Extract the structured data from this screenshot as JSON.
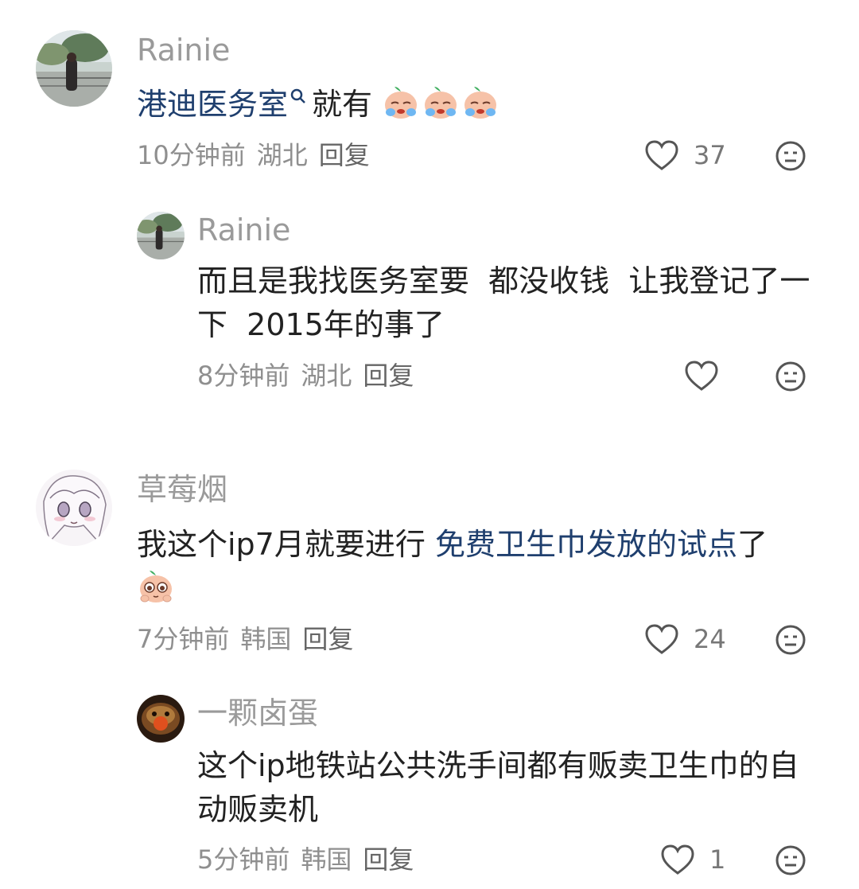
{
  "comments": [
    {
      "username": "Rainie",
      "text_link": "港迪医务室",
      "text_after": "就有",
      "time": "10分钟前",
      "location": "湖北",
      "reply": "回复",
      "likes": "37"
    },
    {
      "username": "Rainie",
      "text": "而且是我找医务室要  都没收钱  让我登记了一下  2015年的事了",
      "time": "8分钟前",
      "location": "湖北",
      "reply": "回复"
    },
    {
      "username": "草莓烟",
      "text_before": "我这个ip7月就要进行 ",
      "text_link": "免费卫生巾发放的试点",
      "text_after": "了",
      "time": "7分钟前",
      "location": "韩国",
      "reply": "回复",
      "likes": "24"
    },
    {
      "username": "一颗卤蛋",
      "text": "这个ip地铁站公共洗手间都有贩卖卫生巾的自动贩卖机",
      "time": "5分钟前",
      "location": "韩国",
      "reply": "回复",
      "likes": "1"
    }
  ],
  "colors": {
    "link": "#1f3f6e",
    "meta": "#8f8f8f",
    "username": "#9a9a9a"
  },
  "icons": [
    "heart-outline-icon",
    "neutral-face-icon",
    "search-icon",
    "crying-emoji",
    "pleading-emoji"
  ]
}
